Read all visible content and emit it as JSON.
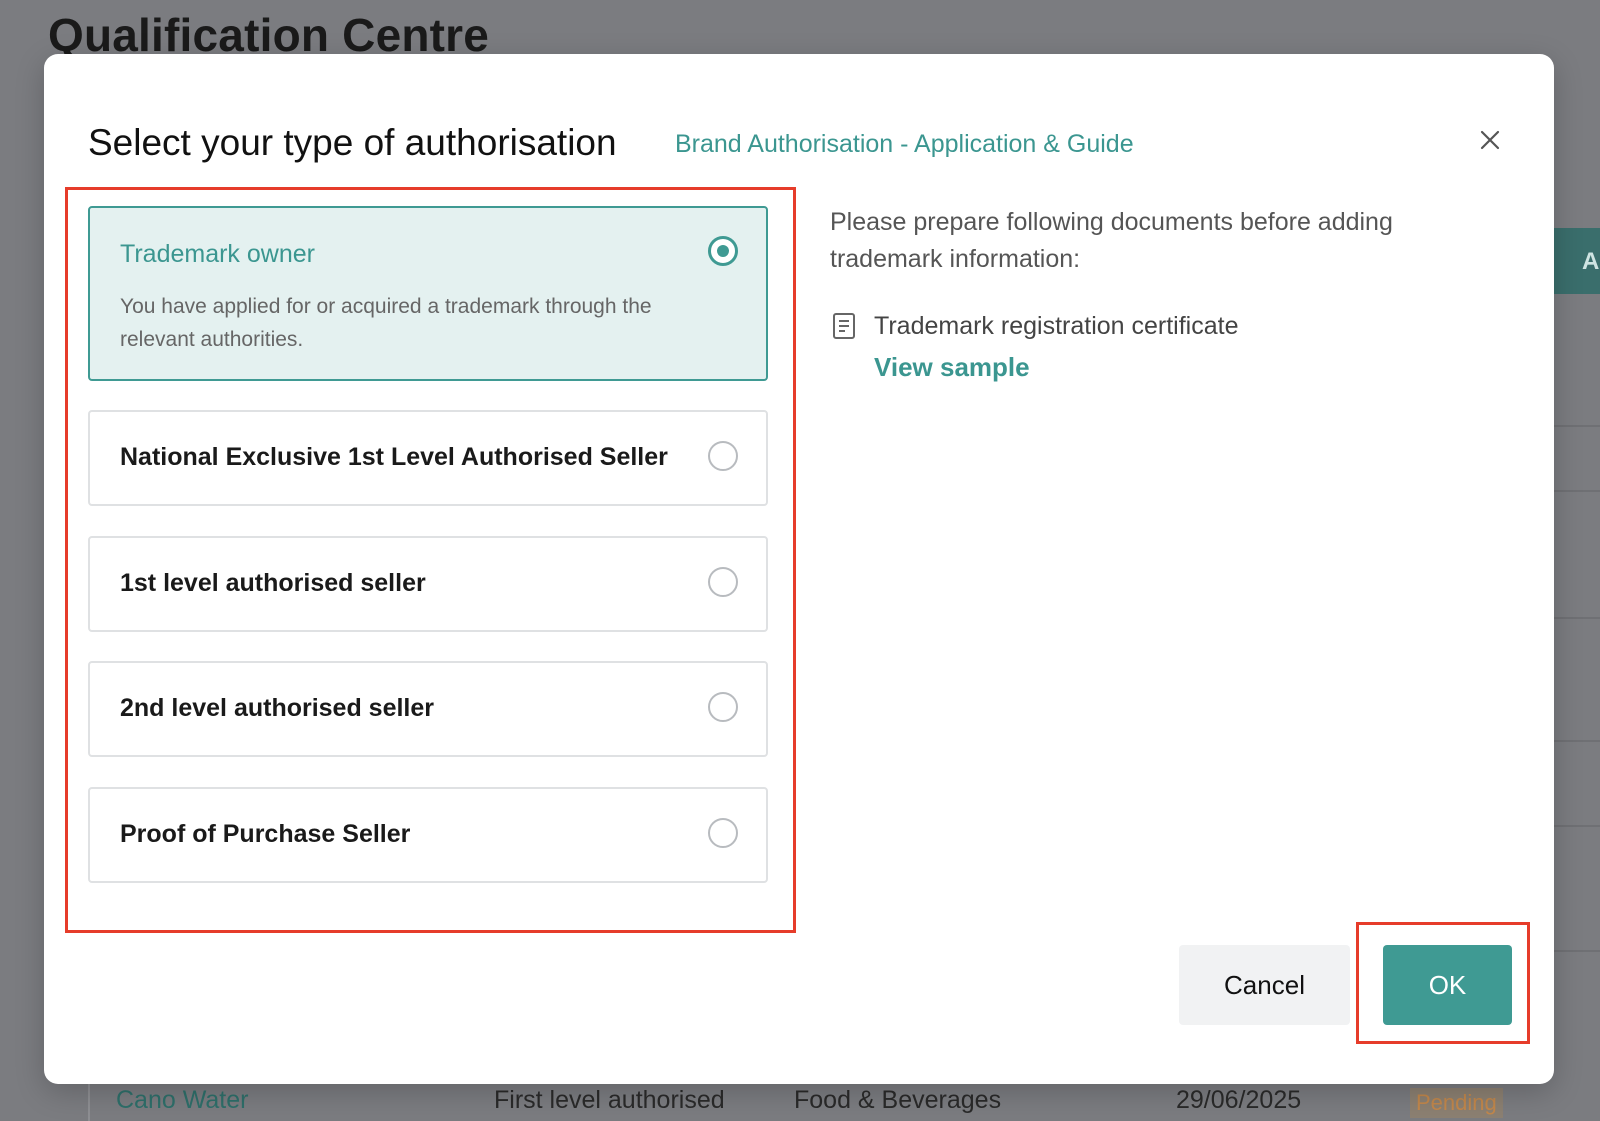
{
  "background": {
    "page_title": "Qualification Centre",
    "side_button_fragment": "Ac",
    "row": {
      "brand": "Cano Water",
      "level": "First level authorised",
      "category": "Food & Beverages",
      "date": "29/06/2025",
      "status": "Pending"
    }
  },
  "modal": {
    "title": "Select your type of authorisation",
    "guide_link": "Brand Authorisation - Application & Guide",
    "close_icon": "close-icon",
    "options": [
      {
        "title": "Trademark owner",
        "description": "You have applied for or acquired a trademark through the relevant authorities.",
        "selected": true
      },
      {
        "title": "National Exclusive 1st Level Authorised Seller",
        "selected": false
      },
      {
        "title": "1st level authorised seller",
        "selected": false
      },
      {
        "title": "2nd level authorised seller",
        "selected": false
      },
      {
        "title": "Proof of Purchase Seller",
        "selected": false
      }
    ],
    "info": {
      "prepare_text": "Please prepare following documents before adding trademark information:",
      "document_icon": "document-icon",
      "document_name": "Trademark registration certificate",
      "view_sample": "View sample"
    },
    "buttons": {
      "cancel": "Cancel",
      "ok": "OK"
    }
  },
  "colors": {
    "accent": "#3f9a93",
    "highlight_frame": "#e63c2a",
    "overlay": "#7b7c80"
  }
}
